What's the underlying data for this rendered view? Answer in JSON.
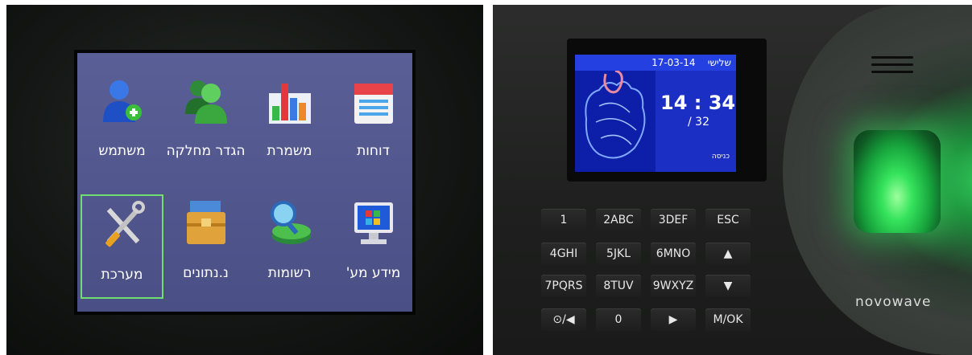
{
  "menu": {
    "items": [
      {
        "label": "משתמש",
        "icon": "user-add-icon"
      },
      {
        "label": "הגדר מחלקה",
        "icon": "department-users-icon"
      },
      {
        "label": "משמרת",
        "icon": "shift-bar-chart-icon"
      },
      {
        "label": "דוחות",
        "icon": "calendar-report-icon"
      },
      {
        "label": "מערכת",
        "icon": "tools-icon"
      },
      {
        "label": "נ.נתונים",
        "icon": "toolbox-icon"
      },
      {
        "label": "רשומות",
        "icon": "records-search-icon"
      },
      {
        "label": "מידע מע'",
        "icon": "system-info-monitor-icon"
      }
    ],
    "selected": "מערכת"
  },
  "device": {
    "date": "17-03-14",
    "day": "שלישי",
    "time_hours": "14",
    "time_minutes": "34",
    "time_separator": ":",
    "sub_value": "/ 32",
    "state": "כניסה",
    "brand": "novowave",
    "keys": [
      [
        "1",
        "2ABC",
        "3DEF",
        "ESC"
      ],
      [
        "4GHI",
        "5JKL",
        "6MNO",
        "▲"
      ],
      [
        "7PQRS",
        "8TUV",
        "9WXYZ",
        "▼"
      ],
      [
        "⊙/◀",
        "0",
        "▶",
        "M/OK"
      ]
    ]
  },
  "colors": {
    "screen_bg": "#4e5390",
    "lcd_blue": "#1b2fc4",
    "selection_border": "#6fe06f",
    "sensor_green": "#35e35c"
  }
}
